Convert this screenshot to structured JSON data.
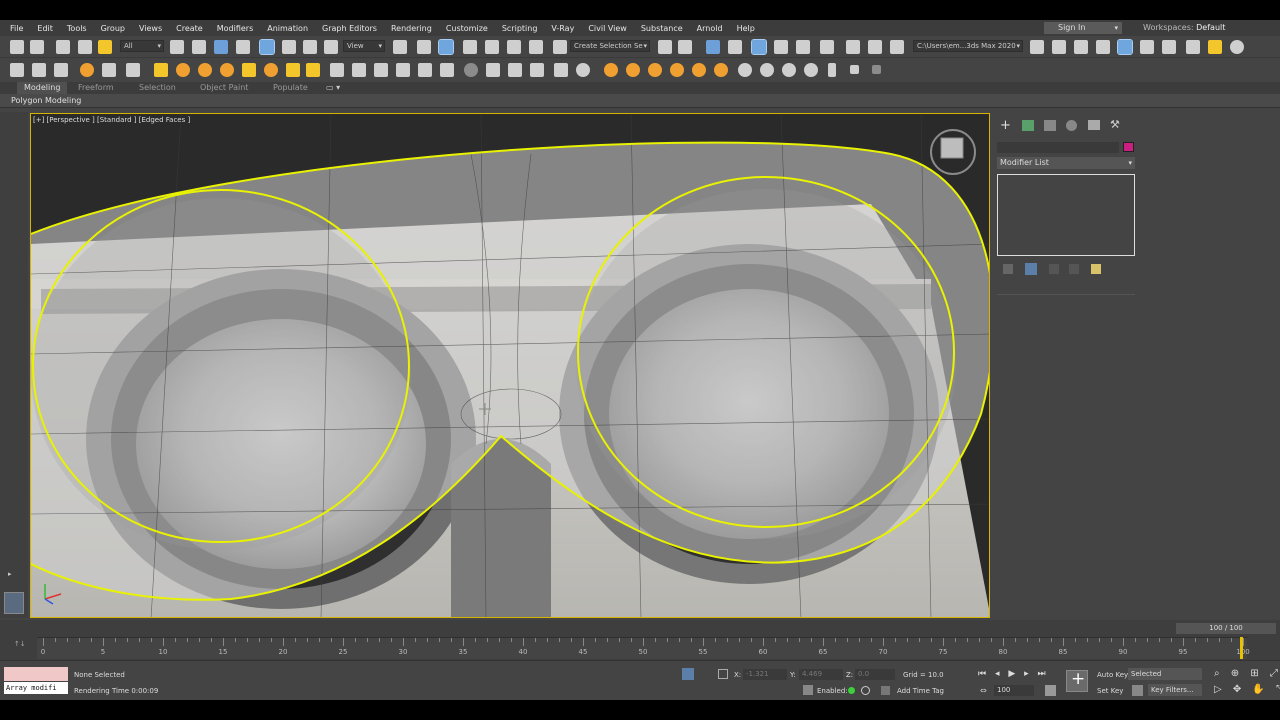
{
  "menu": {
    "items": [
      "File",
      "Edit",
      "Tools",
      "Group",
      "Views",
      "Create",
      "Modifiers",
      "Animation",
      "Graph Editors",
      "Rendering",
      "Customize",
      "Scripting",
      "V-Ray",
      "Civil View",
      "Substance",
      "Arnold",
      "Help"
    ],
    "sign_in": "Sign In",
    "workspace_label": "Workspaces:",
    "workspace_value": "Default"
  },
  "toolbar": {
    "selection_filter": "All",
    "view_dropdown": "View",
    "named_selection": "Create Selection Se",
    "project_path": "C:\\Users\\em...3ds Max 2020"
  },
  "ribbon": {
    "tabs": [
      "Modeling",
      "Freeform",
      "Selection",
      "Object Paint",
      "Populate"
    ],
    "active_tab": "Modeling",
    "panel_title": "Polygon Modeling"
  },
  "viewport": {
    "label": "[+] [Perspective ] [Standard ] [Edged Faces ]"
  },
  "command_panel": {
    "modifier_list": "Modifier List",
    "object_color": "#c81f80"
  },
  "timeline": {
    "frame_display": "100 / 100",
    "tick_labels": [
      "0",
      "5",
      "10",
      "15",
      "20",
      "25",
      "30",
      "35",
      "40",
      "45",
      "50",
      "55",
      "60",
      "65",
      "70",
      "75",
      "80",
      "85",
      "90",
      "95",
      "100"
    ]
  },
  "status": {
    "maxscript_text": "Array modifi",
    "selection": "None Selected",
    "render_time": "Rendering Time  0:00:09",
    "x_label": "X:",
    "x_value": "-1.321",
    "y_label": "Y:",
    "y_value": "4.469",
    "z_label": "Z:",
    "z_value": "0.0",
    "grid": "Grid = 10.0",
    "enabled": "Enabled:",
    "add_time_tag": "Add Time Tag",
    "auto_key": "Auto Key",
    "set_key": "Set Key",
    "selected": "Selected",
    "key_filters": "Key Filters...",
    "current_frame": "100"
  },
  "colors": {
    "selection_outline": "#e9f200",
    "viewport_border": "#d6b400"
  }
}
